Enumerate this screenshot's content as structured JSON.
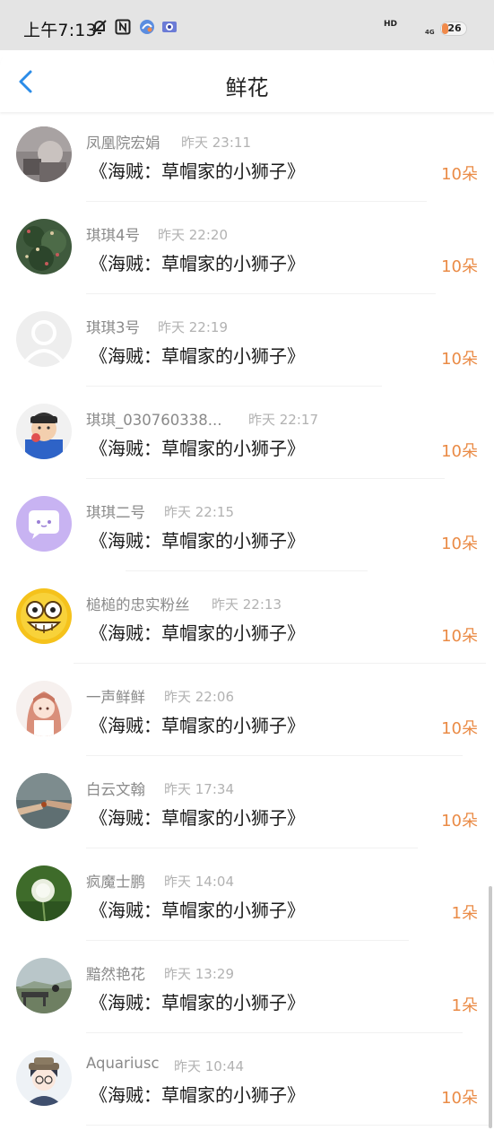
{
  "status_bar": {
    "time": "上午7:13",
    "hd": "HD",
    "signal": "4G",
    "battery": "26",
    "battery_percent": 26,
    "icons": [
      "mute-bell-icon",
      "nfc-icon",
      "app-icon",
      "app-icon"
    ]
  },
  "header": {
    "title": "鲜花",
    "back_icon": "chevron-left-icon"
  },
  "colors": {
    "count": "#ea8b46",
    "back": "#2b8ce8",
    "nick": "#8a8a8a",
    "time": "#b2b2b2"
  },
  "items": [
    {
      "name": "凤凰院宏娟",
      "time": "昨天 23:11",
      "song": "《海贼：草帽家的小狮子》",
      "count": "10朵",
      "avatar": "photo-avatar"
    },
    {
      "name": "琪琪4号",
      "time": "昨天 22:20",
      "song": "《海贼：草帽家的小狮子》",
      "count": "10朵",
      "avatar": "tree-avatar"
    },
    {
      "name": "琪琪3号",
      "time": "昨天 22:19",
      "song": "《海贼：草帽家的小狮子》",
      "count": "10朵",
      "avatar": "default-avatar"
    },
    {
      "name": "琪琪_030760338...",
      "time": "昨天 22:17",
      "song": "《海贼：草帽家的小狮子》",
      "count": "10朵",
      "avatar": "child-avatar"
    },
    {
      "name": "琪琪二号",
      "time": "昨天 22:15",
      "song": "《海贼：草帽家的小狮子》",
      "count": "10朵",
      "avatar": "chat-bubble-avatar"
    },
    {
      "name": "槌槌的忠实粉丝",
      "time": "昨天 22:13",
      "song": "《海贼：草帽家的小狮子》",
      "count": "10朵",
      "avatar": "cartoon-face-avatar"
    },
    {
      "name": "一声鲜鲜",
      "time": "昨天 22:06",
      "song": "《海贼：草帽家的小狮子》",
      "count": "10朵",
      "avatar": "anime-girl-avatar"
    },
    {
      "name": "白云文翰",
      "time": "昨天 17:34",
      "song": "《海贼：草帽家的小狮子》",
      "count": "10朵",
      "avatar": "hands-avatar"
    },
    {
      "name": "疯魔士鹏",
      "time": "昨天 14:04",
      "song": "《海贼：草帽家的小狮子》",
      "count": "1朵",
      "avatar": "dandelion-avatar"
    },
    {
      "name": "黯然艳花",
      "time": "昨天 13:29",
      "song": "《海贼：草帽家的小狮子》",
      "count": "1朵",
      "avatar": "landscape-avatar"
    },
    {
      "name": "Aquariusc",
      "time": "昨天 10:44",
      "song": "《海贼：草帽家的小狮子》",
      "count": "10朵",
      "avatar": "anime-boy-avatar"
    }
  ]
}
